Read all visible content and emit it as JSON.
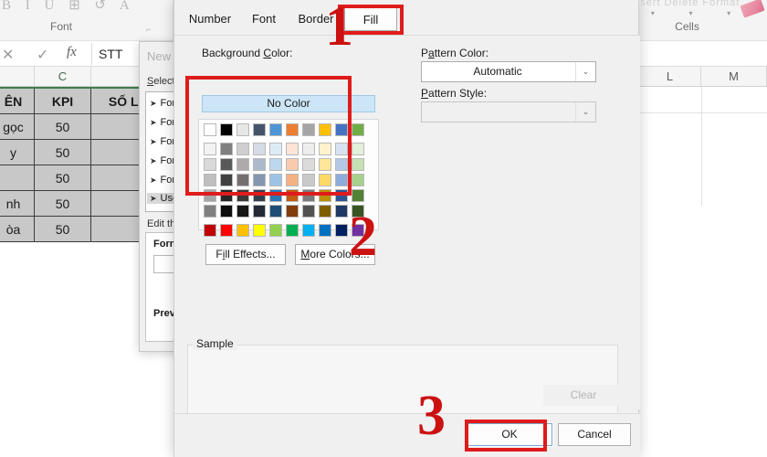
{
  "background": {
    "ribbon": {
      "icons_text": "B I U ⊞ ↺ A",
      "group_label": "Font",
      "dialog_launcher": "⌐",
      "cells_labels": "Insert  Delete  Format",
      "cells_group_label": "Cells",
      "caret": "▾"
    },
    "formula_bar": {
      "cancel_icon": "✕",
      "confirm_icon": "✓",
      "function_icon": "fx",
      "value": "STT"
    },
    "columns": [
      {
        "label": "C",
        "dim": false
      },
      {
        "label": "L",
        "dim": true
      },
      {
        "label": "M",
        "dim": true
      }
    ],
    "table": {
      "headers": [
        "ÊN",
        "KPI",
        "SỐ LƯỢ"
      ],
      "rows": [
        [
          "gọc",
          "50",
          ""
        ],
        [
          "y",
          "50",
          ""
        ],
        [
          "",
          "50",
          ""
        ],
        [
          "nh",
          "50",
          ""
        ],
        [
          "òa",
          "50",
          ""
        ]
      ]
    }
  },
  "rule_dialog": {
    "title": "New F",
    "select_label_pre": "S",
    "select_label_post": "elect a",
    "rule_items": [
      "For",
      "For",
      "For",
      "For",
      "For",
      "Use"
    ],
    "arrow_glyph": "➤",
    "edit_label": "Edit the",
    "format_label": "Form",
    "preview_label": "Previ"
  },
  "format_cells": {
    "tabs": [
      {
        "label": "Number",
        "active": false
      },
      {
        "label": "Font",
        "active": false
      },
      {
        "label": "Border",
        "active": false
      },
      {
        "label": "Fill",
        "active": true
      }
    ],
    "background_color": {
      "label_pre": "Background ",
      "label_accel": "C",
      "label_post": "olor:",
      "no_color_label": "No Color"
    },
    "pattern_color": {
      "label_pre": "P",
      "label_accel": "a",
      "label_post": "ttern Color:",
      "value": "Automatic"
    },
    "pattern_style": {
      "label_pre": "",
      "label_accel": "P",
      "label_post": "attern Style:",
      "value": ""
    },
    "dropdown_arrow": "⌄",
    "buttons": {
      "fill_effects_pre": "F",
      "fill_effects_accel": "i",
      "fill_effects_post": "ll Effects...",
      "more_colors_pre": "",
      "more_colors_accel": "M",
      "more_colors_post": "ore Colors...",
      "clear": "Clear",
      "ok": "OK",
      "cancel": "Cancel"
    },
    "sample_label": "Sample",
    "palette": {
      "theme_row": [
        "#ffffff",
        "#000000",
        "#e7e6e6",
        "#44546a",
        "#4f94d4",
        "#ed7d31",
        "#a5a5a5",
        "#ffc000",
        "#4472c4",
        "#70ad47"
      ],
      "tint_rows": [
        [
          "#f2f2f2",
          "#7f7f7f",
          "#d0cece",
          "#d6dce4",
          "#ddebf7",
          "#fce4d6",
          "#ededed",
          "#fff2cc",
          "#d9e2f3",
          "#e2efd9"
        ],
        [
          "#d9d9d9",
          "#595959",
          "#aeaaaa",
          "#acb9ca",
          "#bdd7ee",
          "#f8cbad",
          "#dbdbdb",
          "#ffe699",
          "#b4c7e7",
          "#c5e0b3"
        ],
        [
          "#bfbfbf",
          "#404040",
          "#757070",
          "#8496b0",
          "#9cc3e5",
          "#f4b183",
          "#c9c9c9",
          "#ffd965",
          "#8faadc",
          "#a8d08d"
        ],
        [
          "#a6a6a6",
          "#262626",
          "#3b3838",
          "#333f4f",
          "#2e75b6",
          "#c55a11",
          "#7b7b7b",
          "#bf8f00",
          "#2f5496",
          "#538135"
        ],
        [
          "#808080",
          "#0d0d0d",
          "#171616",
          "#222a35",
          "#1f4e79",
          "#833c0c",
          "#525252",
          "#7f6000",
          "#1f3864",
          "#375623"
        ]
      ],
      "standard_row": [
        "#c00000",
        "#ff0000",
        "#ffc000",
        "#ffff00",
        "#92d050",
        "#00b050",
        "#00b0f0",
        "#0070c0",
        "#002060",
        "#7030a0"
      ]
    }
  },
  "annotations": {
    "accent_color": "#cc1111",
    "steps": [
      {
        "number": "1"
      },
      {
        "number": "2"
      },
      {
        "number": "3"
      }
    ]
  }
}
